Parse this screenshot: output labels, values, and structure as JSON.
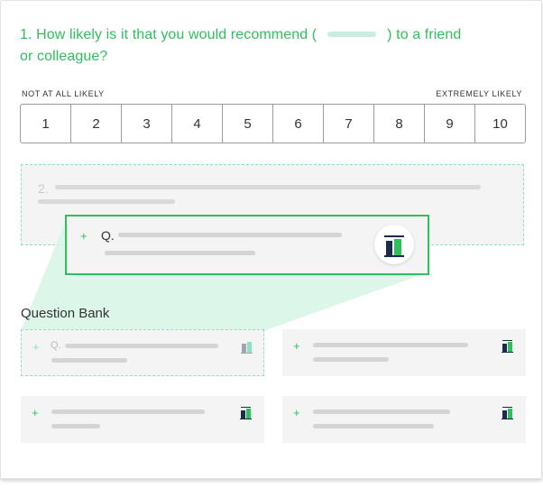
{
  "question": {
    "number_and_text": "1. How likely is it that you would recommend (",
    "tail_text": ") to a friend",
    "line2": "or colleague?"
  },
  "scale": {
    "left_label": "NOT AT ALL LIKELY",
    "right_label": "EXTREMELY LIKELY",
    "options": [
      "1",
      "2",
      "3",
      "4",
      "5",
      "6",
      "7",
      "8",
      "9",
      "10"
    ]
  },
  "drop_zone": {
    "number": "2."
  },
  "drag_card": {
    "plus": "+",
    "label": "Q."
  },
  "question_bank": {
    "title": "Question Bank",
    "items": [
      {
        "plus": "+",
        "label": "Q."
      },
      {
        "plus": "+",
        "label": ""
      },
      {
        "plus": "+",
        "label": ""
      },
      {
        "plus": "+",
        "label": ""
      }
    ]
  },
  "colors": {
    "accent": "#2fbf5d",
    "navy": "#1b2b4b",
    "dashed": "#8fe0bc",
    "ghost": "#f4f4f4"
  },
  "icons": [
    "bar-chart-icon",
    "plus-icon"
  ]
}
